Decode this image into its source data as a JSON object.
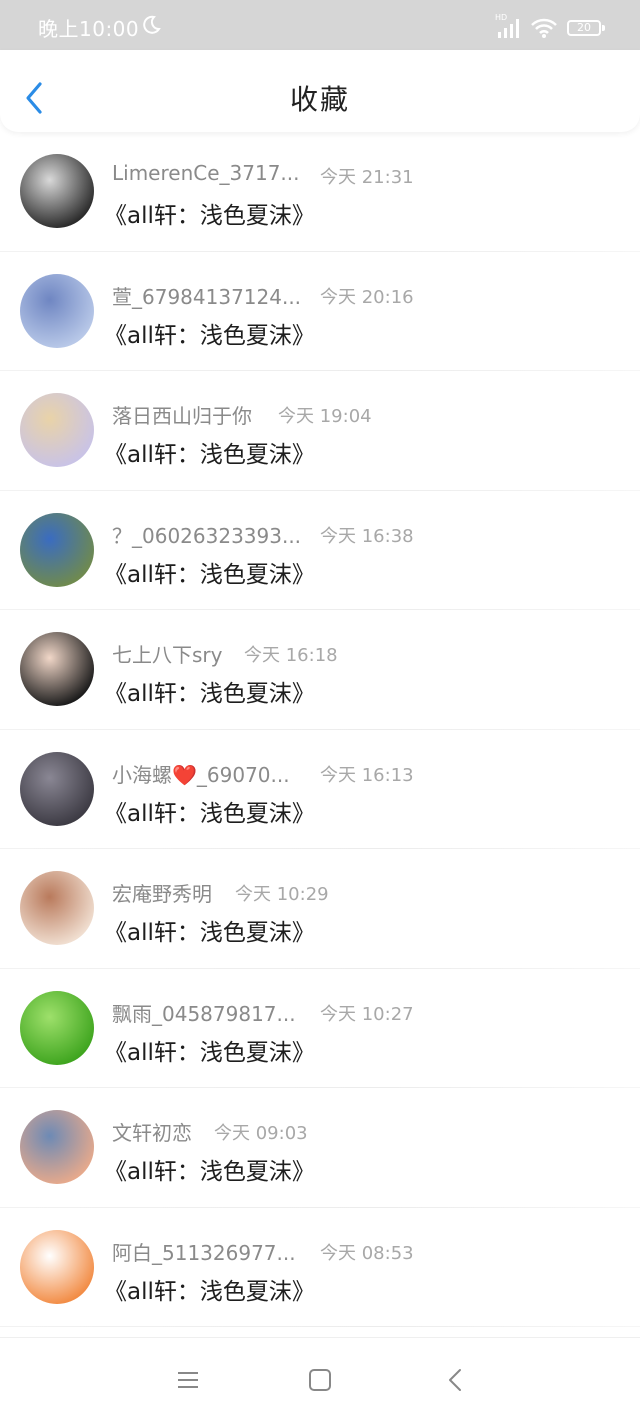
{
  "statusbar": {
    "time": "晚上10:00",
    "hd_label": "HD",
    "battery": "20"
  },
  "header": {
    "title": "收藏",
    "back_icon": "chevron-left-icon"
  },
  "items": [
    {
      "username": "LimerenCe_3717...",
      "time": "今天 21:31",
      "content": "《all轩：浅色夏沫》",
      "avatar_colors": [
        "#2b2b2b",
        "#d9d9d9"
      ]
    },
    {
      "username": "萱_67984137124...",
      "time": "今天 20:16",
      "content": "《all轩：浅色夏沫》",
      "avatar_colors": [
        "#b8c8e8",
        "#6f86c2"
      ]
    },
    {
      "username": "落日西山归于你",
      "time": "今天 19:04",
      "content": "《all轩：浅色夏沫》",
      "avatar_colors": [
        "#c9c3e6",
        "#e9d3a8"
      ]
    },
    {
      "username": "？_06026323393...",
      "time": "今天 16:38",
      "content": "《all轩：浅色夏沫》",
      "avatar_colors": [
        "#6f8a4e",
        "#3a6cc1"
      ]
    },
    {
      "username": "七上八下sry",
      "time": "今天 16:18",
      "content": "《all轩：浅色夏沫》",
      "avatar_colors": [
        "#1c1c1c",
        "#f1d7c8"
      ]
    },
    {
      "username": "小海螺❤️_69070...",
      "time": "今天 16:13",
      "content": "《all轩：浅色夏沫》",
      "avatar_colors": [
        "#3d3b44",
        "#8a8794"
      ]
    },
    {
      "username": "宏庵野秀明",
      "time": "今天 10:29",
      "content": "《all轩：浅色夏沫》",
      "avatar_colors": [
        "#f0ded0",
        "#b97a5c"
      ]
    },
    {
      "username": "飘雨_045879817...",
      "time": "今天 10:27",
      "content": "《all轩：浅色夏沫》",
      "avatar_colors": [
        "#3fa51f",
        "#9ee06b"
      ]
    },
    {
      "username": "文轩初恋",
      "time": "今天 09:03",
      "content": "《all轩：浅色夏沫》",
      "avatar_colors": [
        "#e6a98c",
        "#6d8ab5"
      ]
    },
    {
      "username": "阿白_511326977...",
      "time": "今天 08:53",
      "content": "《all轩：浅色夏沫》",
      "avatar_colors": [
        "#f28c45",
        "#ffffff"
      ]
    }
  ],
  "navbar": {
    "menu_icon": "menu-icon",
    "home_icon": "square-home-icon",
    "back_icon": "triangle-back-icon"
  },
  "colors": {
    "accent": "#2b8ce6",
    "statusbar_bg": "#d6d6d6"
  }
}
